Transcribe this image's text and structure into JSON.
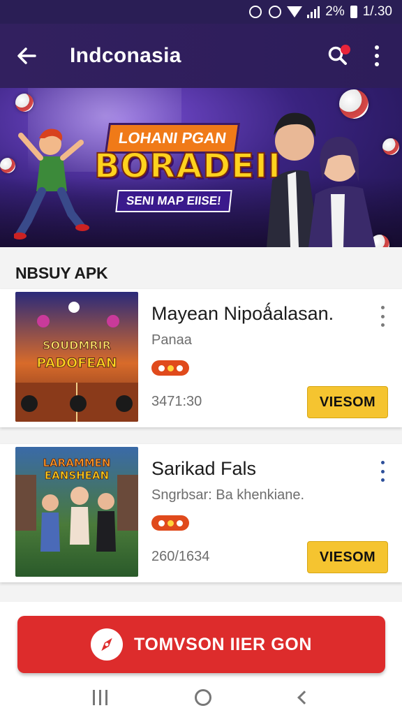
{
  "status_bar": {
    "battery_text": "2%",
    "time": "1/.30"
  },
  "app_bar": {
    "title": "Indconasia"
  },
  "banner": {
    "top_text": "LOHANI PGAN",
    "main_text": "BORADEII",
    "sub_text": "SENI MAP EIISE!"
  },
  "section": {
    "title": "NBSUY APK"
  },
  "cards": [
    {
      "title": "Mayean Nipoǻalasan.",
      "subtitle": "Panaa",
      "count": "3471:30",
      "button_label": "VIESOM",
      "thumb_text_1": "SOUDMRIR",
      "thumb_text_2": "PADOFEAN"
    },
    {
      "title": "Sarikad Fals",
      "subtitle": "Sngrbsar: Ba khenkiane.",
      "count": "260/1634",
      "button_label": "VIESOM",
      "thumb_text_1": "LARAMMEN",
      "thumb_text_2": "EANSHEAN"
    }
  ],
  "cta": {
    "label": "TOMVSON IIER GON"
  },
  "colors": {
    "header": "#2d1d5a",
    "cta": "#dd2c2c",
    "button": "#f5c430",
    "pill": "#e04a1c"
  },
  "icons": [
    "back-arrow-icon",
    "search-icon",
    "more-vert-icon",
    "alarm-icon",
    "wifi-icon",
    "signal-icon",
    "battery-icon",
    "compass-icon",
    "recents-icon",
    "home-icon",
    "nav-back-icon"
  ]
}
